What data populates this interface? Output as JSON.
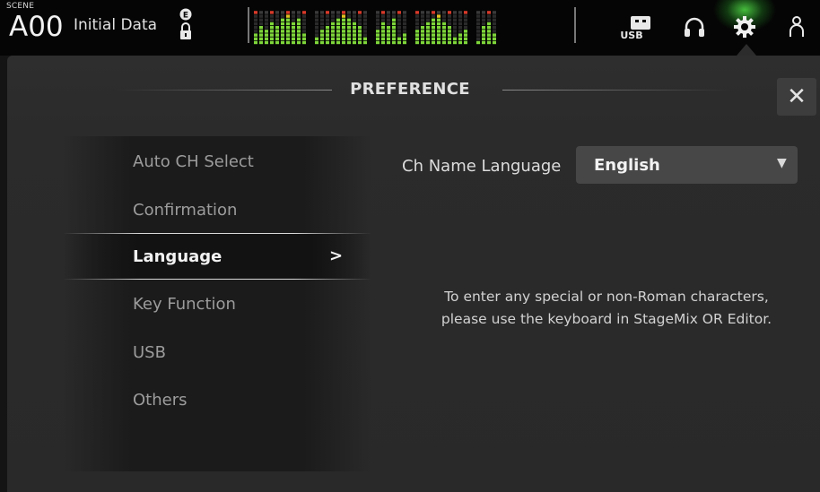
{
  "topbar": {
    "scene_label": "SCENE",
    "scene_number": "A00",
    "scene_name": "Initial Data",
    "icons": [
      "e-lock-icon",
      "level-meters",
      "usb-icon",
      "headphones-icon",
      "gear-icon",
      "user-icon"
    ],
    "usb_label": "USB",
    "accent_glow": "#4fd64a"
  },
  "panel": {
    "title": "PREFERENCE",
    "close_label": "✕"
  },
  "menu": {
    "items": [
      "Auto CH Select",
      "Confirmation",
      "Language",
      "Key Function",
      "USB",
      "Others"
    ],
    "active_index": 2,
    "active_arrow": ">"
  },
  "language": {
    "field_label": "Ch Name Language",
    "selected_value": "English",
    "dropdown_arrow": "▼",
    "note_line1": "To enter any special or non-Roman characters,",
    "note_line2": "please use the keyboard in StageMix OR Editor."
  }
}
